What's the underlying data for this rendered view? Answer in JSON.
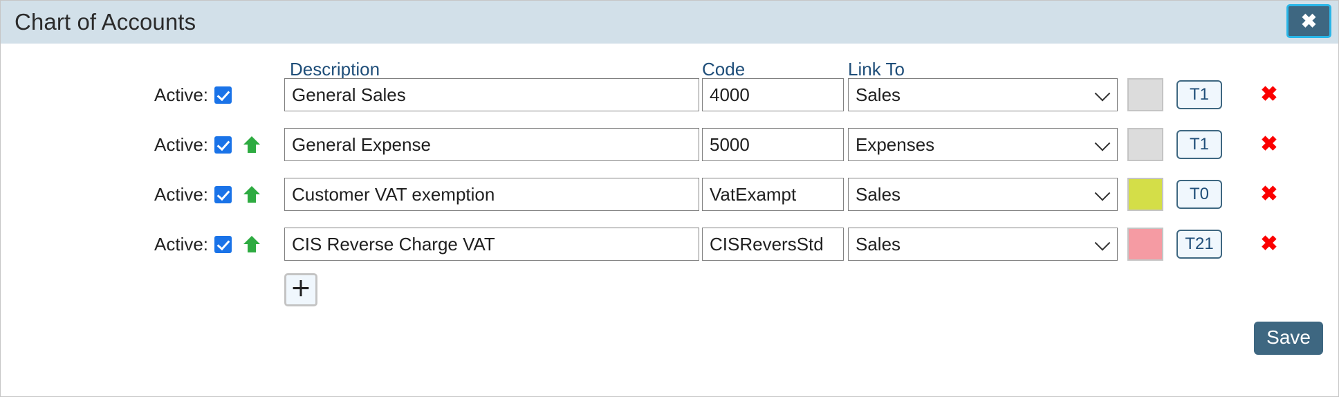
{
  "dialog": {
    "title": "Chart of Accounts",
    "close_icon": "close-icon",
    "close_label": "✖"
  },
  "columns": {
    "active": "Active:",
    "description": "Description",
    "code": "Code",
    "link_to": "Link To"
  },
  "rows": [
    {
      "active": true,
      "active_label": "Active:",
      "can_move_up": false,
      "description": "General Sales",
      "code": "4000",
      "link_to": "Sales",
      "color": "#dcdcdc",
      "tax_code": "T1",
      "delete_label": "✖"
    },
    {
      "active": true,
      "active_label": "Active:",
      "can_move_up": true,
      "description": "General Expense",
      "code": "5000",
      "link_to": "Expenses",
      "color": "#dcdcdc",
      "tax_code": "T1",
      "delete_label": "✖"
    },
    {
      "active": true,
      "active_label": "Active:",
      "can_move_up": true,
      "description": "Customer VAT exemption",
      "code": "VatExampt",
      "link_to": "Sales",
      "color": "#d4de48",
      "tax_code": "T0",
      "delete_label": "✖"
    },
    {
      "active": true,
      "active_label": "Active:",
      "can_move_up": true,
      "description": "CIS Reverse Charge VAT",
      "code": "CISReversStd",
      "link_to": "Sales",
      "color": "#f59ba3",
      "tax_code": "T21",
      "delete_label": "✖"
    }
  ],
  "link_to_options": [
    "Sales",
    "Expenses"
  ],
  "add_button": {
    "label": "＋"
  },
  "footer": {
    "save_label": "Save"
  },
  "theme": {
    "titlebar_bg": "#d2e0e9",
    "accent": "#3e6781",
    "header_text": "#1f4e79",
    "checkbox": "#1a73e8",
    "move_up_arrow": "#2eab41",
    "delete_red": "#fb0000"
  }
}
